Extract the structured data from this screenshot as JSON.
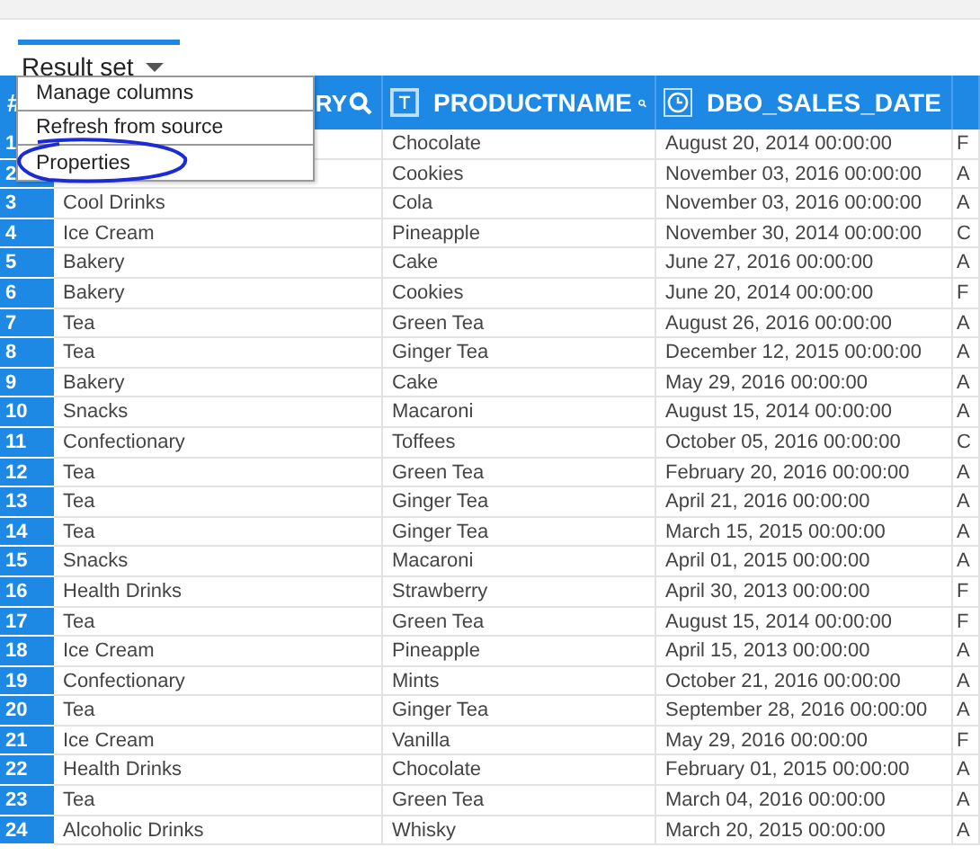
{
  "result_tab": {
    "label": "Result set",
    "selected": true
  },
  "menu": {
    "items": [
      {
        "label": "Manage columns",
        "circled": false
      },
      {
        "label": "Refresh from source",
        "circled": false
      },
      {
        "label": "Properties",
        "circled": true
      }
    ]
  },
  "table": {
    "columns": [
      {
        "label": "#",
        "kind": "index"
      },
      {
        "label": "RY",
        "kind": "category"
      },
      {
        "label": "PRODUCTNAME",
        "kind": "text"
      },
      {
        "label": "DBO_SALES_DATE",
        "kind": "date"
      },
      {
        "kind": "cut"
      }
    ],
    "rows": [
      {
        "n": "1",
        "product": "Chocolate",
        "date": "August 20, 2014 00:00:00",
        "column_4": "F"
      },
      {
        "n": "2",
        "product": "Cookies",
        "date": "November 03, 2016 00:00:00",
        "column_4": "A"
      },
      {
        "n": "3",
        "category": "Cool Drinks",
        "product": "Cola",
        "date": "November 03, 2016 00:00:00",
        "column_4": "A"
      },
      {
        "n": "4",
        "category": "Ice Cream",
        "product": "Pineapple",
        "date": "November 30, 2014 00:00:00",
        "column_4": "C"
      },
      {
        "n": "5",
        "category": "Bakery",
        "product": "Cake",
        "date": "June 27, 2016 00:00:00",
        "column_4": "A"
      },
      {
        "n": "6",
        "category": "Bakery",
        "product": "Cookies",
        "date": "June 20, 2014 00:00:00",
        "column_4": "F"
      },
      {
        "n": "7",
        "category": "Tea",
        "product": "Green Tea",
        "date": "August 26, 2016 00:00:00",
        "column_4": "A"
      },
      {
        "n": "8",
        "category": "Tea",
        "product": "Ginger Tea",
        "date": "December 12, 2015 00:00:00",
        "column_4": "A"
      },
      {
        "n": "9",
        "category": "Bakery",
        "product": "Cake",
        "date": "May 29, 2016 00:00:00",
        "column_4": "A"
      },
      {
        "n": "10",
        "category": "Snacks",
        "product": "Macaroni",
        "date": "August 15, 2014 00:00:00",
        "column_4": "A"
      },
      {
        "n": "11",
        "category": "Confectionary",
        "product": "Toffees",
        "date": "October 05, 2016 00:00:00",
        "column_4": "C"
      },
      {
        "n": "12",
        "category": "Tea",
        "product": "Green Tea",
        "date": "February 20, 2016 00:00:00",
        "column_4": "A"
      },
      {
        "n": "13",
        "category": "Tea",
        "product": "Ginger Tea",
        "date": "April 21, 2016 00:00:00",
        "column_4": "A"
      },
      {
        "n": "14",
        "category": "Tea",
        "product": "Ginger Tea",
        "date": "March 15, 2015 00:00:00",
        "column_4": "A"
      },
      {
        "n": "15",
        "category": "Snacks",
        "product": "Macaroni",
        "date": "April 01, 2015 00:00:00",
        "column_4": "A"
      },
      {
        "n": "16",
        "category": "Health Drinks",
        "product": "Strawberry",
        "date": "April 30, 2013 00:00:00",
        "column_4": "F"
      },
      {
        "n": "17",
        "category": "Tea",
        "product": "Green Tea",
        "date": "August 15, 2014 00:00:00",
        "column_4": "F"
      },
      {
        "n": "18",
        "category": "Ice Cream",
        "product": "Pineapple",
        "date": "April 15, 2013 00:00:00",
        "column_4": "A"
      },
      {
        "n": "19",
        "category": "Confectionary",
        "product": "Mints",
        "date": "October 21, 2016 00:00:00",
        "column_4": "A"
      },
      {
        "n": "20",
        "category": "Tea",
        "product": "Ginger Tea",
        "date": "September 28, 2016 00:00:00",
        "column_4": "A"
      },
      {
        "n": "21",
        "category": "Ice Cream",
        "product": "Vanilla",
        "date": "May 29, 2016 00:00:00",
        "column_4": "F"
      },
      {
        "n": "22",
        "category": "Health Drinks",
        "product": "Chocolate",
        "date": "February 01, 2015 00:00:00",
        "column_4": "A"
      },
      {
        "n": "23",
        "category": "Tea",
        "product": "Green Tea",
        "date": "March 04, 2016 00:00:00",
        "column_4": "A"
      },
      {
        "n": "24",
        "category": "Alcoholic Drinks",
        "product": "Whisky",
        "date": "March 20, 2015 00:00:00",
        "column_4": "A"
      }
    ]
  }
}
